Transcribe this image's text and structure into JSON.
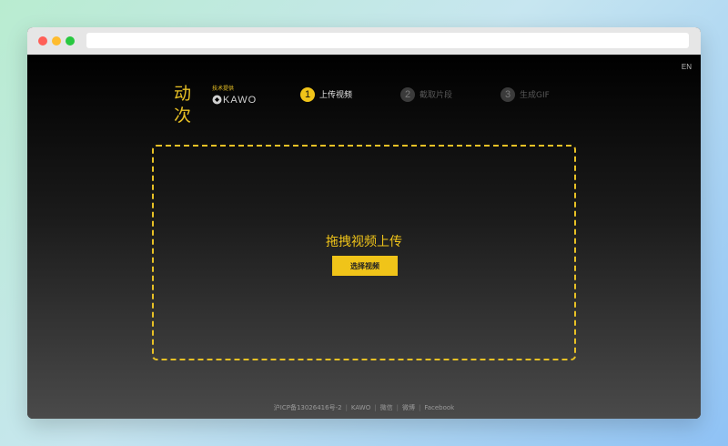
{
  "browser": {
    "url": ""
  },
  "header": {
    "lang_switch": "EN",
    "logo": {
      "cn": "动次",
      "small": "技术提供",
      "en": "KAWO"
    },
    "steps": [
      {
        "number": "1",
        "label": "上传视频",
        "state": "active"
      },
      {
        "number": "2",
        "label": "截取片段",
        "state": "inactive"
      },
      {
        "number": "3",
        "label": "生成GIF",
        "state": "inactive"
      }
    ]
  },
  "upload": {
    "title": "拖拽视频上传",
    "button_label": "选择视频"
  },
  "footer": {
    "icp": "沪ICP备13026416号-2",
    "links": [
      "KAWO",
      "微信",
      "微博",
      "Facebook"
    ]
  },
  "colors": {
    "accent": "#f0c419",
    "inactive_step": "#3b3b3b",
    "background_top": "#000000",
    "background_bottom": "#4a4a4a"
  }
}
